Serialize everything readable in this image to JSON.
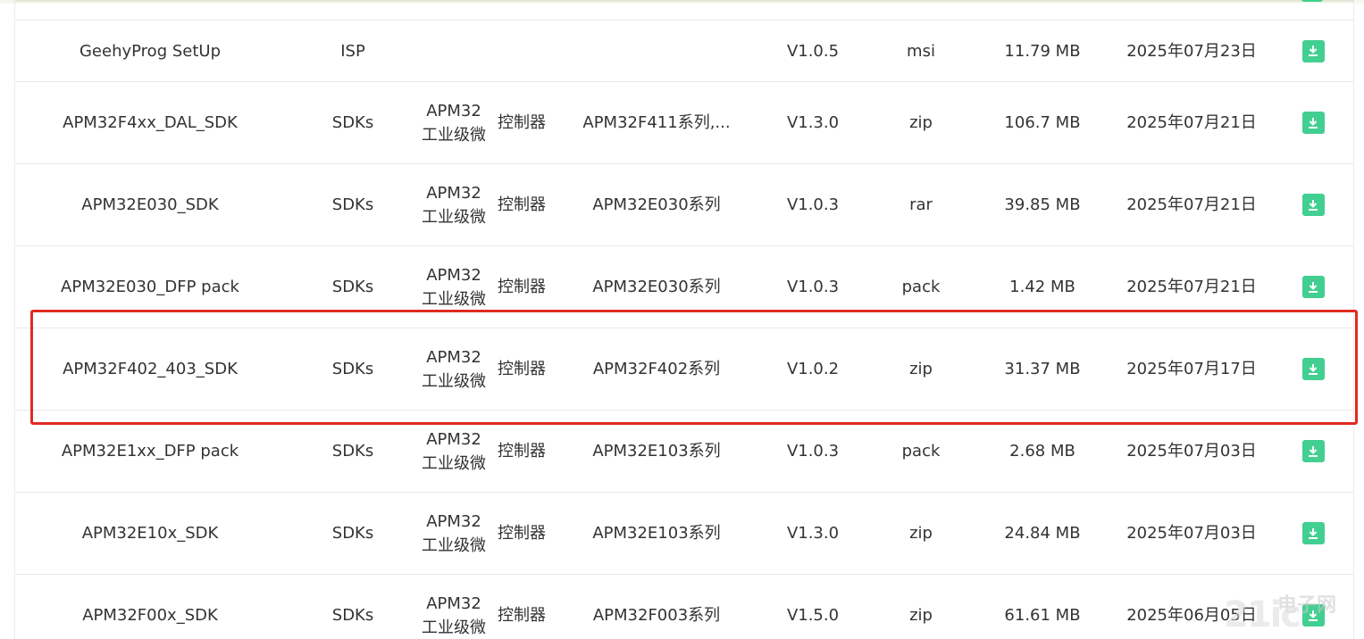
{
  "rows": [
    {
      "name": "GeehyProg SetUp",
      "type": "ISP",
      "category": [
        "",
        ""
      ],
      "series": "",
      "version": "V1.0.5",
      "format": "msi",
      "size": "11.79 MB",
      "date": "2025年07月23日"
    },
    {
      "name": "APM32F4xx_DAL_SDK",
      "type": "SDKs",
      "category": [
        "APM32工业级微",
        "控制器"
      ],
      "series": "APM32F411系列,...",
      "version": "V1.3.0",
      "format": "zip",
      "size": "106.7 MB",
      "date": "2025年07月21日"
    },
    {
      "name": "APM32E030_SDK",
      "type": "SDKs",
      "category": [
        "APM32工业级微",
        "控制器"
      ],
      "series": "APM32E030系列",
      "version": "V1.0.3",
      "format": "rar",
      "size": "39.85 MB",
      "date": "2025年07月21日"
    },
    {
      "name": "APM32E030_DFP pack",
      "type": "SDKs",
      "category": [
        "APM32工业级微",
        "控制器"
      ],
      "series": "APM32E030系列",
      "version": "V1.0.3",
      "format": "pack",
      "size": "1.42 MB",
      "date": "2025年07月21日"
    },
    {
      "name": "APM32F402_403_SDK",
      "type": "SDKs",
      "category": [
        "APM32工业级微",
        "控制器"
      ],
      "series": "APM32F402系列",
      "version": "V1.0.2",
      "format": "zip",
      "size": "31.37 MB",
      "date": "2025年07月17日"
    },
    {
      "name": "APM32E1xx_DFP pack",
      "type": "SDKs",
      "category": [
        "APM32工业级微",
        "控制器"
      ],
      "series": "APM32E103系列",
      "version": "V1.0.3",
      "format": "pack",
      "size": "2.68 MB",
      "date": "2025年07月03日"
    },
    {
      "name": "APM32E10x_SDK",
      "type": "SDKs",
      "category": [
        "APM32工业级微",
        "控制器"
      ],
      "series": "APM32E103系列",
      "version": "V1.3.0",
      "format": "zip",
      "size": "24.84 MB",
      "date": "2025年07月03日"
    },
    {
      "name": "APM32F00x_SDK",
      "type": "SDKs",
      "category": [
        "APM32工业级微",
        "控制器"
      ],
      "series": "APM32F003系列",
      "version": "V1.5.0",
      "format": "zip",
      "size": "61.61 MB",
      "date": "2025年06月05日"
    }
  ],
  "icons": {
    "download": "download-icon"
  },
  "colors": {
    "download_button": "#42cf91",
    "highlight_border": "#e02b20"
  },
  "watermark": {
    "logo": "21ic",
    "text": "电子网"
  }
}
